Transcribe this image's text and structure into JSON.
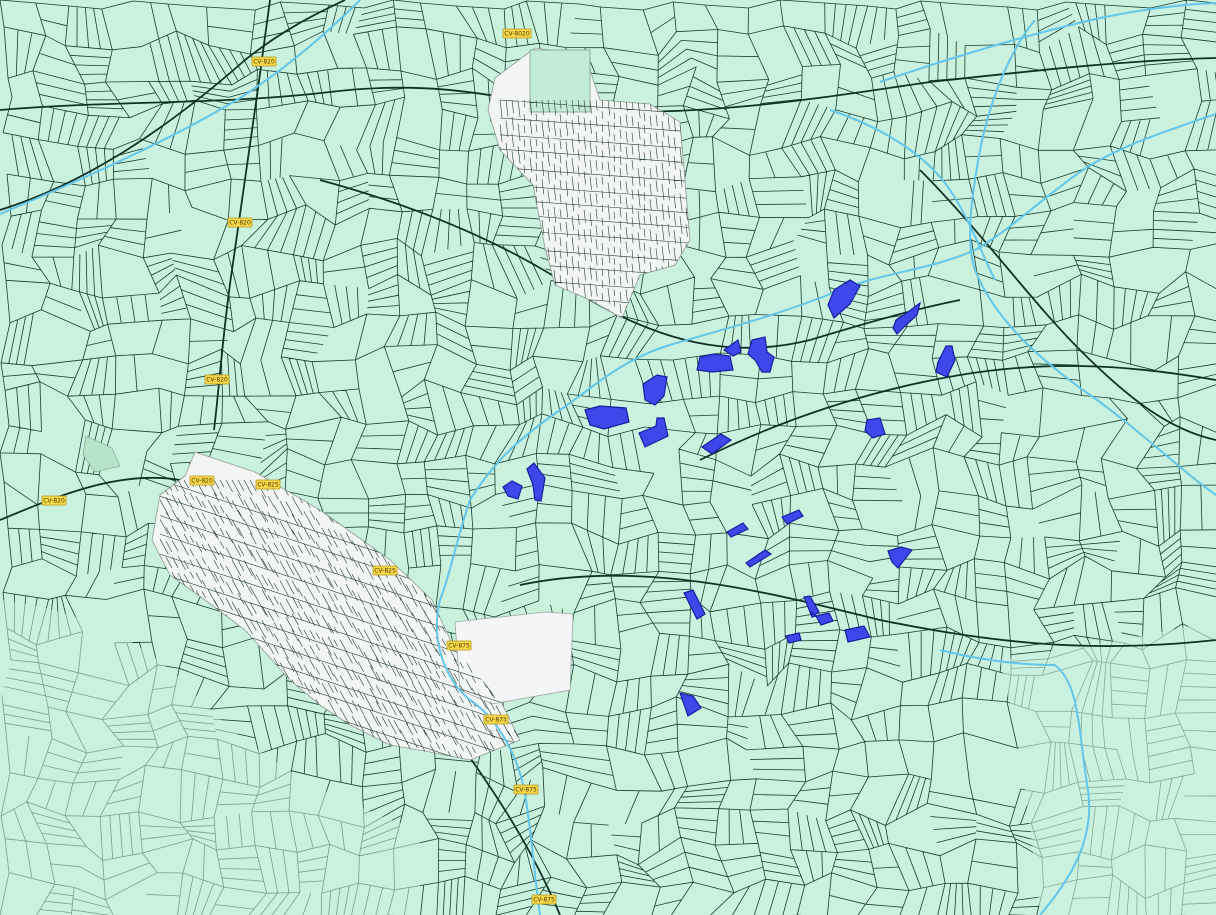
{
  "map": {
    "background_color": "#c9f1dd",
    "parcel_line_color": "#173d2f",
    "urban_fill_color": "#f2f5f4",
    "water_color": "#62c6ea",
    "highlight_fill_color": "#3d47ea",
    "highlight_stroke_color": "#1a1e9d",
    "road_label_color": "#f7d84a"
  },
  "road_labels": [
    {
      "id": "cv-north-village",
      "text": "CV-8020"
    },
    {
      "id": "cv-west-top",
      "text": "CV-820"
    },
    {
      "id": "cv-west-mid",
      "text": "CV-820"
    },
    {
      "id": "cv-west-lower",
      "text": "CV-820"
    },
    {
      "id": "cv-west-edge",
      "text": "CV-820"
    },
    {
      "id": "cv-town-west",
      "text": "CV-820"
    },
    {
      "id": "cv-town-northeast",
      "text": "CV-825"
    },
    {
      "id": "cv-town-east",
      "text": "CV-825"
    },
    {
      "id": "cv-town-south",
      "text": "CV-875"
    },
    {
      "id": "cv-river-upper",
      "text": "CV-875"
    },
    {
      "id": "cv-river-lower",
      "text": "CV-875"
    },
    {
      "id": "cv-south-edge",
      "text": "CV-875"
    }
  ],
  "highlighted_parcels_count": 24
}
